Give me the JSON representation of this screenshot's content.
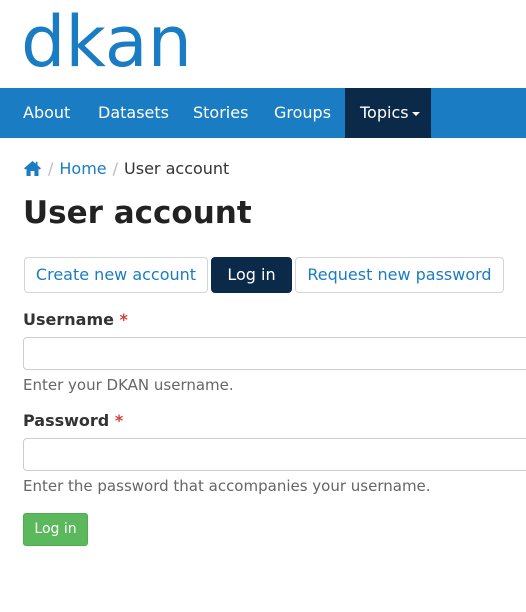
{
  "brand": {
    "logo_text": "dkan",
    "logo_color": "#1a7cc2"
  },
  "nav": {
    "color": "#1a7cc2",
    "active_color": "#0b2a4a",
    "items": [
      {
        "label": "About"
      },
      {
        "label": "Datasets"
      },
      {
        "label": "Stories"
      },
      {
        "label": "Groups"
      },
      {
        "label": "Topics",
        "has_dropdown": true,
        "active": true
      }
    ]
  },
  "breadcrumb": {
    "home_icon": "home-icon",
    "items": [
      {
        "label": "Home",
        "link": true
      },
      {
        "label": "User account",
        "link": false
      }
    ]
  },
  "page": {
    "title": "User account"
  },
  "tabs": [
    {
      "label": "Create new account",
      "active": false
    },
    {
      "label": "Log in",
      "active": true
    },
    {
      "label": "Request new password",
      "active": false
    }
  ],
  "form": {
    "username": {
      "label": "Username",
      "required_mark": "*",
      "value": "",
      "help": "Enter your DKAN username."
    },
    "password": {
      "label": "Password",
      "required_mark": "*",
      "value": "",
      "help": "Enter the password that accompanies your username."
    },
    "submit_label": "Log in",
    "submit_color": "#5cb85c"
  }
}
